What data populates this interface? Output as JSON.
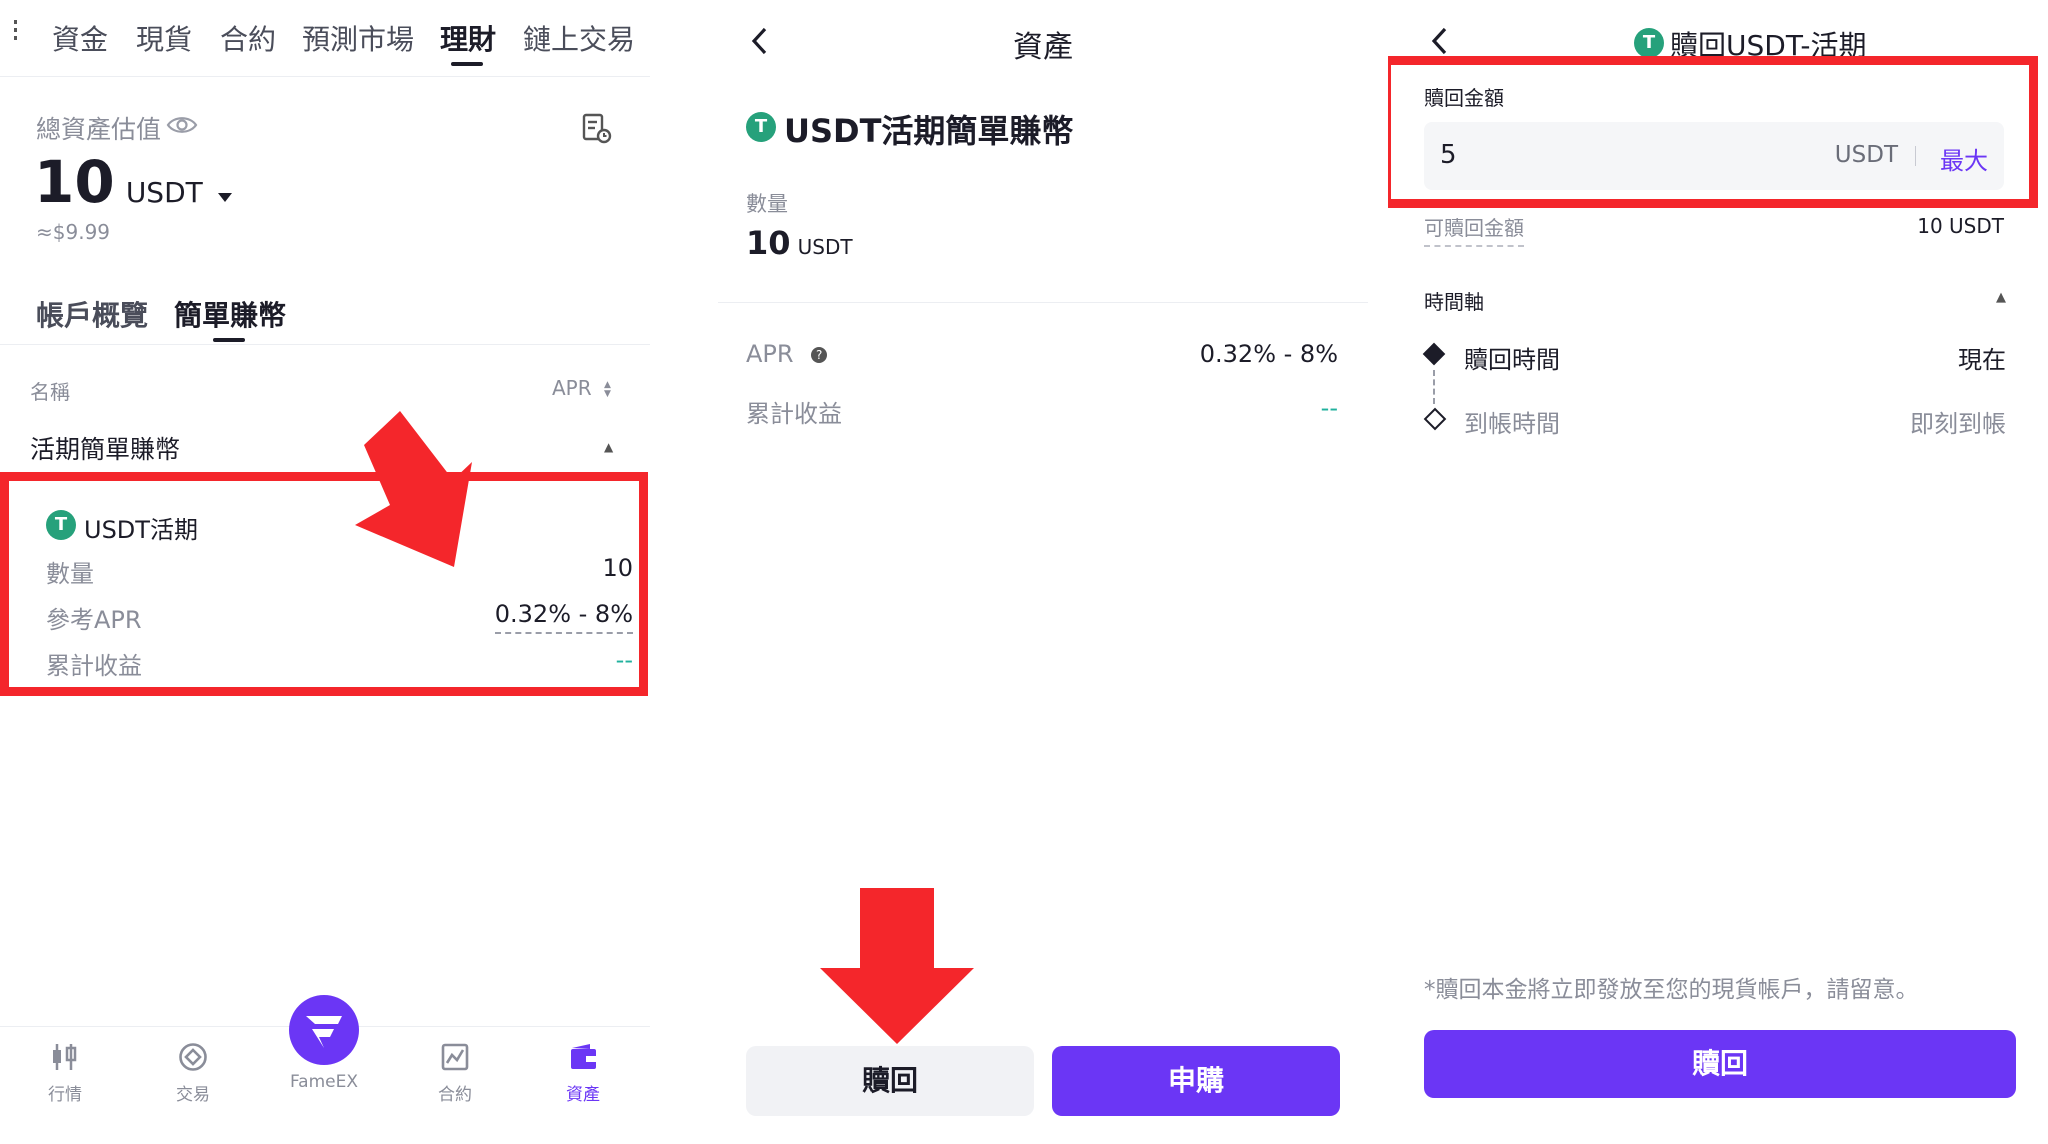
{
  "panel1": {
    "top_tabs": [
      "資金",
      "現貨",
      "合約",
      "預測市場",
      "理財",
      "鏈上交易"
    ],
    "active_top_tab": "理財",
    "total_assets_label": "總資產估值",
    "total_amount": "10",
    "total_unit": "USDT",
    "total_usd": "≈$9.99",
    "sub_tabs": [
      "帳戶概覽",
      "簡單賺幣"
    ],
    "active_sub_tab": "簡單賺幣",
    "col_name": "名稱",
    "col_apr": "APR",
    "section_title": "活期簡單賺幣",
    "card": {
      "title": "USDT活期",
      "rows": [
        {
          "label": "數量",
          "value": "10"
        },
        {
          "label": "參考APR",
          "value": "0.32% - 8%"
        },
        {
          "label": "累計收益",
          "value": "--"
        }
      ]
    },
    "bottom_nav": [
      {
        "label": "行情",
        "icon": "candlestick-icon"
      },
      {
        "label": "交易",
        "icon": "trade-icon"
      },
      {
        "label": "FameEX",
        "icon": "fameex-logo-icon"
      },
      {
        "label": "合約",
        "icon": "futures-chart-icon"
      },
      {
        "label": "資產",
        "icon": "wallet-icon"
      }
    ],
    "active_nav": "資產"
  },
  "panel2": {
    "title": "資產",
    "product_title": "USDT活期簡單賺幣",
    "qty_label": "數量",
    "qty_value": "10",
    "qty_unit": "USDT",
    "apr_label": "APR",
    "apr_value": "0.32% - 8%",
    "earnings_label": "累計收益",
    "earnings_value": "--",
    "redeem_button": "贖回",
    "subscribe_button": "申購"
  },
  "panel3": {
    "title": "贖回USDT-活期",
    "amount_label": "贖回金額",
    "amount_value": "5",
    "amount_unit": "USDT",
    "max_label": "最大",
    "available_label": "可贖回金額",
    "available_value": "10 USDT",
    "timeline_label": "時間軸",
    "timeline": [
      {
        "label": "贖回時間",
        "value": "現在"
      },
      {
        "label": "到帳時間",
        "value": "即刻到帳"
      }
    ],
    "notice": "*贖回本金將立即發放至您的現貨帳戶，請留意。",
    "redeem_button": "贖回"
  },
  "colors": {
    "accent": "#6b36f5",
    "highlight_red": "#f4262b",
    "teal": "#21b19e",
    "usdt_green": "#26a17b"
  }
}
